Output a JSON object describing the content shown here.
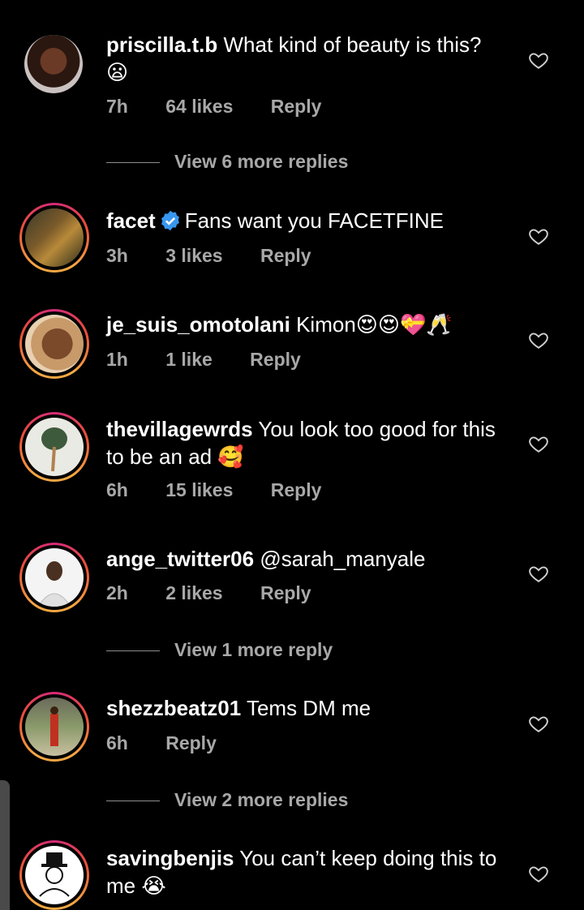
{
  "comments": [
    {
      "user": "priscilla.t.b",
      "text": "What kind of beauty is this?",
      "emoji": "😦",
      "time": "7h",
      "likes": "64 likes",
      "reply": "Reply",
      "view_more": "View 6 more replies"
    },
    {
      "user": "facet",
      "text": "Fans want you FACETFINE",
      "time": "3h",
      "likes": "3 likes",
      "reply": "Reply"
    },
    {
      "user": "je_suis_omotolani",
      "text": "Kimon",
      "emoji": "😍😍💝🥂",
      "time": "1h",
      "likes": "1 like",
      "reply": "Reply"
    },
    {
      "user": "thevillagewrds",
      "text": "You look too good for this to be an ad",
      "emoji": "🥰",
      "time": "6h",
      "likes": "15 likes",
      "reply": "Reply"
    },
    {
      "user": "ange_twitter06",
      "text": "@sarah_manyale",
      "time": "2h",
      "likes": "2 likes",
      "reply": "Reply",
      "view_more": "View 1 more reply"
    },
    {
      "user": "shezzbeatz01",
      "text": "Tems DM me",
      "time": "6h",
      "reply": "Reply",
      "view_more": "View 2 more replies"
    },
    {
      "user": "savingbenjis",
      "text": "You can’t keep doing this to me",
      "emoji": "😭"
    }
  ],
  "icons": {
    "like": "heart-outline-icon",
    "verified": "verified-badge-icon"
  },
  "colors": {
    "background": "#000000",
    "text": "#ffffff",
    "secondary": "#a8a8a8",
    "verified": "#3897f0",
    "story_ring_start": "#d6297a",
    "story_ring_end": "#f5a742"
  }
}
